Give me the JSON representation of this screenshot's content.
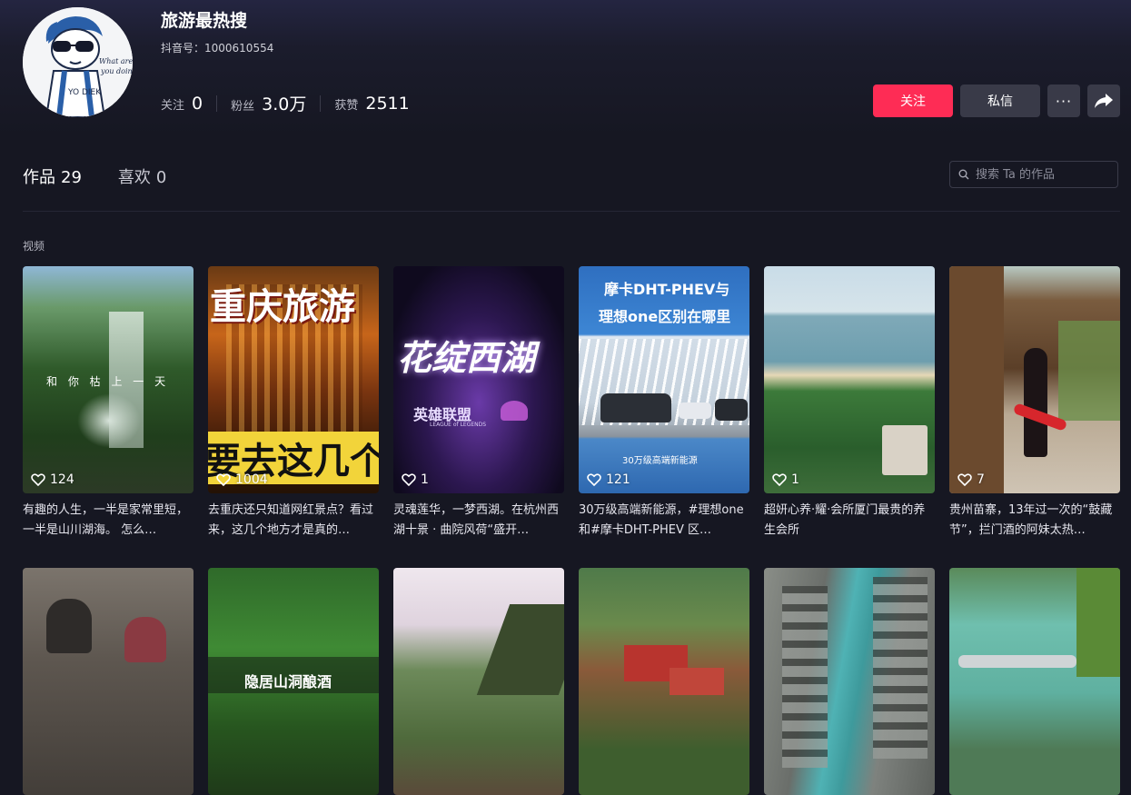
{
  "profile": {
    "name": "旅游最热搜",
    "account": "抖音号：1000610554",
    "avatar_text": "What are you doing?"
  },
  "stats": [
    {
      "label": "关注",
      "value": "0"
    },
    {
      "label": "粉丝",
      "value": "3.0万"
    },
    {
      "label": "获赞",
      "value": "2511"
    }
  ],
  "actions": {
    "follow": "关注",
    "message": "私信",
    "more": "···"
  },
  "tabs": [
    {
      "label": "作品",
      "count": "29"
    },
    {
      "label": "喜欢",
      "count": "0"
    }
  ],
  "search": {
    "placeholder": "搜索 Ta 的作品"
  },
  "section_label": "视频",
  "videos": [
    {
      "likes": "124",
      "title": "有趣的人生，一半是家常里短，一半是山川湖海。 怎么…",
      "overlay": "和 你 枯 上 一 天"
    },
    {
      "likes": "1004",
      "title": "去重庆还只知道网红景点？看过来，这几个地方才是真的…",
      "overlay": "重庆旅游",
      "overlay2": "要去这几个"
    },
    {
      "likes": "1",
      "title": "灵魂莲华，一梦西湖。在杭州西湖十景 · 曲院风荷“盛开…",
      "overlay": "花绽西湖",
      "overlay2": "英雄联盟",
      "overlay3": "LEAGUE of LEGENDS"
    },
    {
      "likes": "121",
      "title": "30万级高端新能源，#理想one 和#摩卡DHT-PHEV 区…",
      "overlay": "摩卡DHT-PHEV与",
      "overlay2": "理想one区别在哪里",
      "overlay3": "30万级高端新能源"
    },
    {
      "likes": "1",
      "title": "超妍心养·耀·会所厦门最贵的养生会所"
    },
    {
      "likes": "7",
      "title": "贵州苗寨，13年过一次的“鼓藏节”，拦门酒的阿妹太热…"
    },
    {
      "likes": "",
      "title": ""
    },
    {
      "likes": "",
      "title": "",
      "overlay": "隐居山洞酿酒"
    },
    {
      "likes": "",
      "title": ""
    },
    {
      "likes": "",
      "title": ""
    },
    {
      "likes": "",
      "title": ""
    },
    {
      "likes": "",
      "title": ""
    }
  ],
  "colors": {
    "background": "#161722",
    "accent": "#fe2c55",
    "secondary_button": "#393a48"
  },
  "icons": [
    "search-icon",
    "heart-icon",
    "share-icon",
    "more-icon"
  ]
}
